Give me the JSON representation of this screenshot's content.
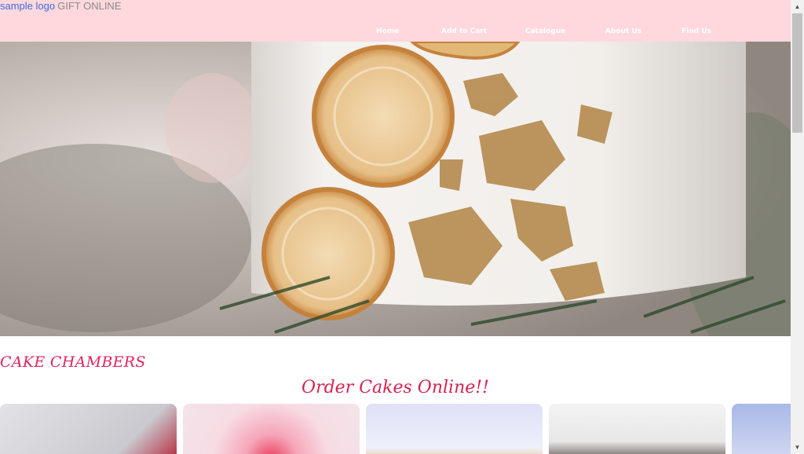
{
  "header": {
    "logo_alt": "sample logo",
    "brand": "GIFT ONLINE",
    "nav": [
      "Home",
      "Add to Cart",
      "Catalogue",
      "About Us",
      "Find Us"
    ]
  },
  "sections": {
    "brand_heading": "CAKE CHAMBERS",
    "order_heading": "Order Cakes Online!!"
  },
  "colors": {
    "header_bg": "#ffd8de",
    "accent": "#e0245e"
  },
  "icons": {
    "scroll_up": "triangle-up-icon",
    "scroll_down": "triangle-down-icon"
  }
}
